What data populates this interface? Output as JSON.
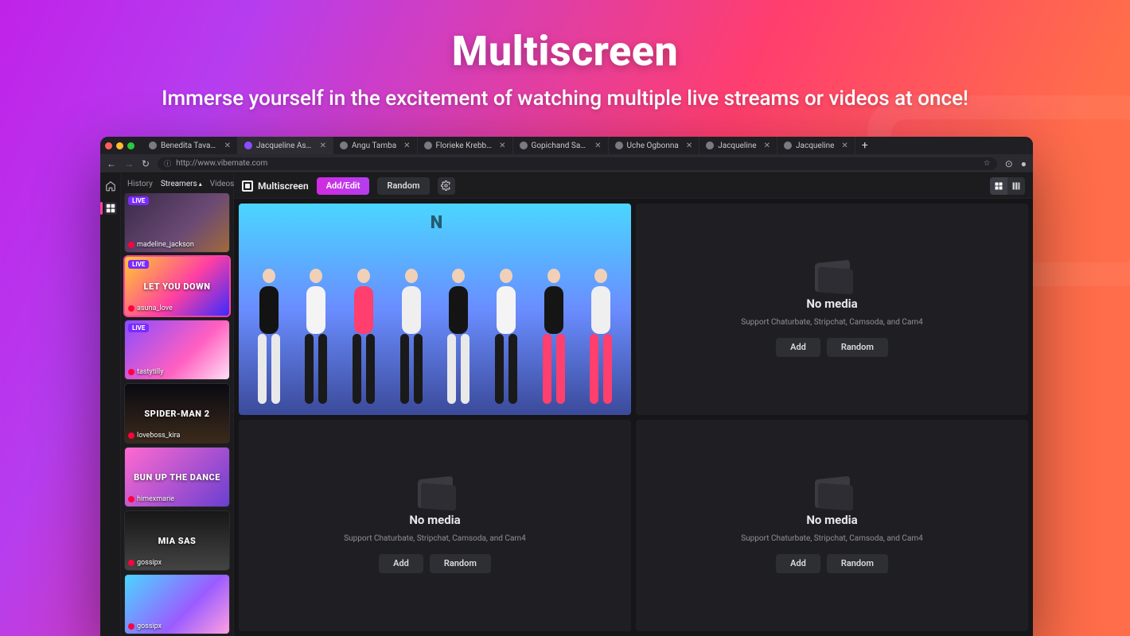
{
  "hero": {
    "title": "Multiscreen",
    "subtitle": "Immerse yourself in the excitement of watching multiple live streams or videos at once!"
  },
  "browser": {
    "url": "http://www.vibemate.com",
    "tabs": [
      {
        "label": "Benedita Tavares"
      },
      {
        "label": "Jacqueline Asong Jacquelin",
        "active": true
      },
      {
        "label": "Angu Tamba"
      },
      {
        "label": "Florieke Krebber"
      },
      {
        "label": "Gopichand Sana"
      },
      {
        "label": "Uche Ogbonna"
      },
      {
        "label": "Jacqueline"
      },
      {
        "label": "Jacqueline"
      }
    ]
  },
  "sidebar": {
    "tabs": {
      "history": "History",
      "streamers": "Streamers",
      "videos": "Videos"
    },
    "live_badge": "LIVE",
    "items": [
      {
        "name": "madeline_jackson",
        "live": true,
        "overlay": ""
      },
      {
        "name": "asuna_love",
        "live": true,
        "overlay": "LET YOU DOWN"
      },
      {
        "name": "tastytilly",
        "live": true,
        "overlay": ""
      },
      {
        "name": "loveboss_kira",
        "live": false,
        "overlay": "SPIDER-MAN 2"
      },
      {
        "name": "himexmarie",
        "live": false,
        "overlay": "BUN UP THE DANCE"
      },
      {
        "name": "gossipx",
        "live": false,
        "overlay": "MIA SAS"
      },
      {
        "name": "gossipx",
        "live": false,
        "overlay": ""
      }
    ]
  },
  "toolbar": {
    "title": "Multiscreen",
    "add_edit": "Add/Edit",
    "random": "Random"
  },
  "slots": {
    "empty_title": "No media",
    "empty_sub": "Support Chaturbate, Stripchat, Camsoda, and Cam4",
    "add": "Add",
    "random": "Random"
  }
}
